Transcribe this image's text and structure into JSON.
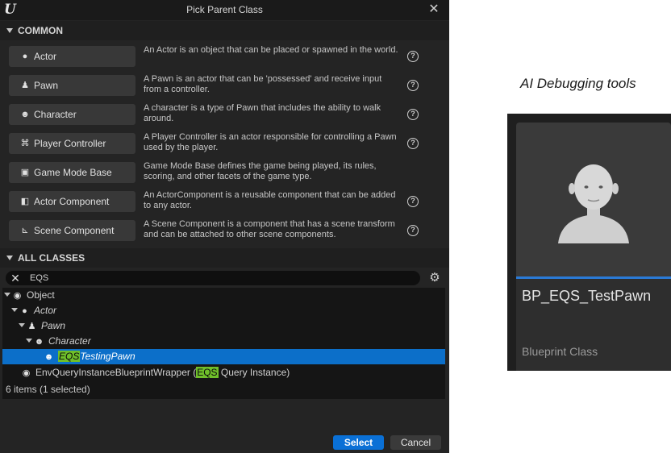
{
  "dialog": {
    "title": "Pick Parent Class",
    "close_label": "✕",
    "logo": "U"
  },
  "common": {
    "header": "COMMON",
    "items": [
      {
        "label": "Actor",
        "icon": "actor-sphere-icon",
        "glyph": "●",
        "desc": "An Actor is an object that can be placed or spawned in the world.",
        "help": "?"
      },
      {
        "label": "Pawn",
        "icon": "pawn-figure-icon",
        "glyph": "♟",
        "desc": "A Pawn is an actor that can be 'possessed' and receive input from a controller.",
        "help": "?"
      },
      {
        "label": "Character",
        "icon": "character-bust-icon",
        "glyph": "☻",
        "desc": "A character is a type of Pawn that includes the ability to walk around.",
        "help": "?"
      },
      {
        "label": "Player Controller",
        "icon": "gamepad-icon",
        "glyph": "⌘",
        "desc": "A Player Controller is an actor responsible for controlling a Pawn used by the player.",
        "help": "?"
      },
      {
        "label": "Game Mode Base",
        "icon": "game-mode-icon",
        "glyph": "▣",
        "desc": "Game Mode Base defines the game being played, its rules, scoring, and other facets of the game type.",
        "help": ""
      },
      {
        "label": "Actor Component",
        "icon": "actor-component-icon",
        "glyph": "◧",
        "desc": "An ActorComponent is a reusable component that can be added to any actor.",
        "help": "?"
      },
      {
        "label": "Scene Component",
        "icon": "scene-component-icon",
        "glyph": "⊾",
        "desc": "A Scene Component is a component that has a scene transform and can be attached to other scene components.",
        "help": "?"
      }
    ]
  },
  "all_classes": {
    "header": "ALL CLASSES",
    "search_value": "EQS",
    "search_clear": "✕",
    "settings_glyph": "⚙",
    "tree": {
      "object": "Object",
      "actor": "Actor",
      "pawn": "Pawn",
      "character": "Character",
      "selected_match": "EQS",
      "selected_rest": "TestingPawn",
      "wrapper_prefix": "EnvQueryInstanceBlueprintWrapper (",
      "wrapper_match": "EQS",
      "wrapper_suffix": " Query Instance)"
    },
    "status": "6 items (1 selected)"
  },
  "footer": {
    "select_label": "Select",
    "cancel_label": "Cancel"
  },
  "right_panel": {
    "caption": "AI Debugging tools",
    "asset_name": "BP_EQS_TestPawn",
    "asset_type": "Blueprint Class",
    "thumbnail_icon": "character-bust-icon"
  },
  "colors": {
    "dialog_bg": "#242424",
    "selection": "#0c6fc9",
    "highlight": "#6fbf2a",
    "select_button": "#0a70d6",
    "asset_bar": "#2a7ad6"
  }
}
